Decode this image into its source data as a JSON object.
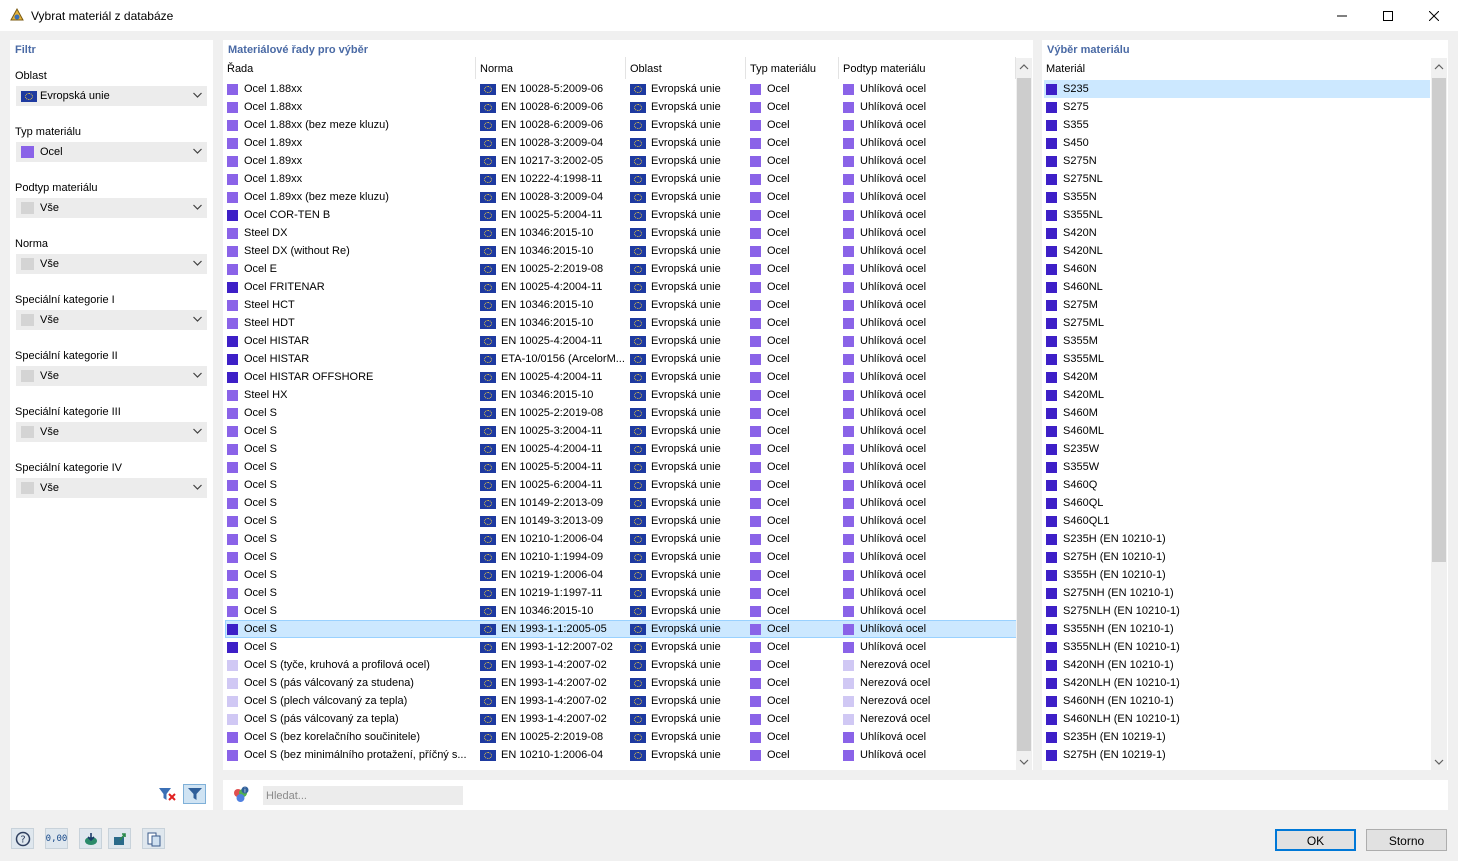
{
  "window": {
    "title": "Vybrat materiál z databáze"
  },
  "filter": {
    "title": "Filtr",
    "fields": [
      {
        "label": "Oblast",
        "value": "Evropská unie",
        "icon": "eu-flag",
        "color": "#1e3aa0"
      },
      {
        "label": "Typ materiálu",
        "value": "Ocel",
        "icon": "material-color",
        "color": "#8a63e8"
      },
      {
        "label": "Podtyp materiálu",
        "value": "Vše",
        "icon": "none",
        "color": "#d4d4d4"
      },
      {
        "label": "Norma",
        "value": "Vše",
        "icon": "none",
        "color": "#d4d4d4"
      },
      {
        "label": "Speciální kategorie I",
        "value": "Vše",
        "icon": "none",
        "color": "#d4d4d4"
      },
      {
        "label": "Speciální kategorie II",
        "value": "Vše",
        "icon": "none",
        "color": "#d4d4d4"
      },
      {
        "label": "Speciální kategorie III",
        "value": "Vše",
        "icon": "none",
        "color": "#d4d4d4"
      },
      {
        "label": "Speciální kategorie IV",
        "value": "Vše",
        "icon": "none",
        "color": "#d4d4d4"
      }
    ],
    "buttons": [
      "clear-filter-icon",
      "filter-icon"
    ]
  },
  "series": {
    "title": "Materiálové řady pro výběr",
    "columns": [
      "Řada",
      "Norma",
      "Oblast",
      "Typ materiálu",
      "Podtyp materiálu"
    ],
    "rows": [
      {
        "name": "Ocel 1.88xx",
        "norm": "EN 10028-5:2009-06",
        "region": "Evropská unie",
        "type": "Ocel",
        "subtype": "Uhlíková ocel",
        "color": "#8a63e8",
        "subcolor": "#8a63e8"
      },
      {
        "name": "Ocel 1.88xx",
        "norm": "EN 10028-6:2009-06",
        "region": "Evropská unie",
        "type": "Ocel",
        "subtype": "Uhlíková ocel",
        "color": "#8a63e8",
        "subcolor": "#8a63e8"
      },
      {
        "name": "Ocel 1.88xx (bez meze kluzu)",
        "norm": "EN 10028-6:2009-06",
        "region": "Evropská unie",
        "type": "Ocel",
        "subtype": "Uhlíková ocel",
        "color": "#8a63e8",
        "subcolor": "#8a63e8"
      },
      {
        "name": "Ocel 1.89xx",
        "norm": "EN 10028-3:2009-04",
        "region": "Evropská unie",
        "type": "Ocel",
        "subtype": "Uhlíková ocel",
        "color": "#8a63e8",
        "subcolor": "#8a63e8"
      },
      {
        "name": "Ocel 1.89xx",
        "norm": "EN 10217-3:2002-05",
        "region": "Evropská unie",
        "type": "Ocel",
        "subtype": "Uhlíková ocel",
        "color": "#8a63e8",
        "subcolor": "#8a63e8"
      },
      {
        "name": "Ocel 1.89xx",
        "norm": "EN 10222-4:1998-11",
        "region": "Evropská unie",
        "type": "Ocel",
        "subtype": "Uhlíková ocel",
        "color": "#8a63e8",
        "subcolor": "#8a63e8"
      },
      {
        "name": "Ocel 1.89xx (bez meze kluzu)",
        "norm": "EN 10028-3:2009-04",
        "region": "Evropská unie",
        "type": "Ocel",
        "subtype": "Uhlíková ocel",
        "color": "#8a63e8",
        "subcolor": "#8a63e8"
      },
      {
        "name": "Ocel COR-TEN B",
        "norm": "EN 10025-5:2004-11",
        "region": "Evropská unie",
        "type": "Ocel",
        "subtype": "Uhlíková ocel",
        "color": "#3d1fc7",
        "subcolor": "#8a63e8"
      },
      {
        "name": "Steel DX",
        "norm": "EN 10346:2015-10",
        "region": "Evropská unie",
        "type": "Ocel",
        "subtype": "Uhlíková ocel",
        "color": "#8a63e8",
        "subcolor": "#8a63e8"
      },
      {
        "name": "Steel DX (without Re)",
        "norm": "EN 10346:2015-10",
        "region": "Evropská unie",
        "type": "Ocel",
        "subtype": "Uhlíková ocel",
        "color": "#8a63e8",
        "subcolor": "#8a63e8"
      },
      {
        "name": "Ocel E",
        "norm": "EN 10025-2:2019-08",
        "region": "Evropská unie",
        "type": "Ocel",
        "subtype": "Uhlíková ocel",
        "color": "#8a63e8",
        "subcolor": "#8a63e8"
      },
      {
        "name": "Ocel FRITENAR",
        "norm": "EN 10025-4:2004-11",
        "region": "Evropská unie",
        "type": "Ocel",
        "subtype": "Uhlíková ocel",
        "color": "#3d1fc7",
        "subcolor": "#8a63e8"
      },
      {
        "name": "Steel HCT",
        "norm": "EN 10346:2015-10",
        "region": "Evropská unie",
        "type": "Ocel",
        "subtype": "Uhlíková ocel",
        "color": "#8a63e8",
        "subcolor": "#8a63e8"
      },
      {
        "name": "Steel HDT",
        "norm": "EN 10346:2015-10",
        "region": "Evropská unie",
        "type": "Ocel",
        "subtype": "Uhlíková ocel",
        "color": "#8a63e8",
        "subcolor": "#8a63e8"
      },
      {
        "name": "Ocel HISTAR",
        "norm": "EN 10025-4:2004-11",
        "region": "Evropská unie",
        "type": "Ocel",
        "subtype": "Uhlíková ocel",
        "color": "#3d1fc7",
        "subcolor": "#8a63e8"
      },
      {
        "name": "Ocel HISTAR",
        "norm": "ETA-10/0156 (ArcelorM...",
        "region": "Evropská unie",
        "type": "Ocel",
        "subtype": "Uhlíková ocel",
        "color": "#3d1fc7",
        "subcolor": "#8a63e8"
      },
      {
        "name": "Ocel HISTAR OFFSHORE",
        "norm": "EN 10025-4:2004-11",
        "region": "Evropská unie",
        "type": "Ocel",
        "subtype": "Uhlíková ocel",
        "color": "#3d1fc7",
        "subcolor": "#8a63e8"
      },
      {
        "name": "Steel HX",
        "norm": "EN 10346:2015-10",
        "region": "Evropská unie",
        "type": "Ocel",
        "subtype": "Uhlíková ocel",
        "color": "#8a63e8",
        "subcolor": "#8a63e8"
      },
      {
        "name": "Ocel S",
        "norm": "EN 10025-2:2019-08",
        "region": "Evropská unie",
        "type": "Ocel",
        "subtype": "Uhlíková ocel",
        "color": "#8a63e8",
        "subcolor": "#8a63e8"
      },
      {
        "name": "Ocel S",
        "norm": "EN 10025-3:2004-11",
        "region": "Evropská unie",
        "type": "Ocel",
        "subtype": "Uhlíková ocel",
        "color": "#8a63e8",
        "subcolor": "#8a63e8"
      },
      {
        "name": "Ocel S",
        "norm": "EN 10025-4:2004-11",
        "region": "Evropská unie",
        "type": "Ocel",
        "subtype": "Uhlíková ocel",
        "color": "#8a63e8",
        "subcolor": "#8a63e8"
      },
      {
        "name": "Ocel S",
        "norm": "EN 10025-5:2004-11",
        "region": "Evropská unie",
        "type": "Ocel",
        "subtype": "Uhlíková ocel",
        "color": "#8a63e8",
        "subcolor": "#8a63e8"
      },
      {
        "name": "Ocel S",
        "norm": "EN 10025-6:2004-11",
        "region": "Evropská unie",
        "type": "Ocel",
        "subtype": "Uhlíková ocel",
        "color": "#8a63e8",
        "subcolor": "#8a63e8"
      },
      {
        "name": "Ocel S",
        "norm": "EN 10149-2:2013-09",
        "region": "Evropská unie",
        "type": "Ocel",
        "subtype": "Uhlíková ocel",
        "color": "#8a63e8",
        "subcolor": "#8a63e8"
      },
      {
        "name": "Ocel S",
        "norm": "EN 10149-3:2013-09",
        "region": "Evropská unie",
        "type": "Ocel",
        "subtype": "Uhlíková ocel",
        "color": "#8a63e8",
        "subcolor": "#8a63e8"
      },
      {
        "name": "Ocel S",
        "norm": "EN 10210-1:2006-04",
        "region": "Evropská unie",
        "type": "Ocel",
        "subtype": "Uhlíková ocel",
        "color": "#8a63e8",
        "subcolor": "#8a63e8"
      },
      {
        "name": "Ocel S",
        "norm": "EN 10210-1:1994-09",
        "region": "Evropská unie",
        "type": "Ocel",
        "subtype": "Uhlíková ocel",
        "color": "#8a63e8",
        "subcolor": "#8a63e8"
      },
      {
        "name": "Ocel S",
        "norm": "EN 10219-1:2006-04",
        "region": "Evropská unie",
        "type": "Ocel",
        "subtype": "Uhlíková ocel",
        "color": "#8a63e8",
        "subcolor": "#8a63e8"
      },
      {
        "name": "Ocel S",
        "norm": "EN 10219-1:1997-11",
        "region": "Evropská unie",
        "type": "Ocel",
        "subtype": "Uhlíková ocel",
        "color": "#8a63e8",
        "subcolor": "#8a63e8"
      },
      {
        "name": "Ocel S",
        "norm": "EN 10346:2015-10",
        "region": "Evropská unie",
        "type": "Ocel",
        "subtype": "Uhlíková ocel",
        "color": "#8a63e8",
        "subcolor": "#8a63e8"
      },
      {
        "name": "Ocel S",
        "norm": "EN 1993-1-1:2005-05",
        "region": "Evropská unie",
        "type": "Ocel",
        "subtype": "Uhlíková ocel",
        "color": "#3d1fc7",
        "subcolor": "#8a63e8",
        "selected": true
      },
      {
        "name": "Ocel S",
        "norm": "EN 1993-1-12:2007-02",
        "region": "Evropská unie",
        "type": "Ocel",
        "subtype": "Uhlíková ocel",
        "color": "#3d1fc7",
        "subcolor": "#8a63e8"
      },
      {
        "name": "Ocel S (tyče, kruhová a profilová ocel)",
        "norm": "EN 1993-1-4:2007-02",
        "region": "Evropská unie",
        "type": "Ocel",
        "subtype": "Nerezová ocel",
        "color": "#d0c8f4",
        "subcolor": "#d0c8f4"
      },
      {
        "name": "Ocel S (pás válcovaný za studena)",
        "norm": "EN 1993-1-4:2007-02",
        "region": "Evropská unie",
        "type": "Ocel",
        "subtype": "Nerezová ocel",
        "color": "#d0c8f4",
        "subcolor": "#d0c8f4"
      },
      {
        "name": "Ocel S (plech válcovaný za tepla)",
        "norm": "EN 1993-1-4:2007-02",
        "region": "Evropská unie",
        "type": "Ocel",
        "subtype": "Nerezová ocel",
        "color": "#d0c8f4",
        "subcolor": "#d0c8f4"
      },
      {
        "name": "Ocel S (pás válcovaný za tepla)",
        "norm": "EN 1993-1-4:2007-02",
        "region": "Evropská unie",
        "type": "Ocel",
        "subtype": "Nerezová ocel",
        "color": "#d0c8f4",
        "subcolor": "#d0c8f4"
      },
      {
        "name": "Ocel S (bez korelačního součinitele)",
        "norm": "EN 10025-2:2019-08",
        "region": "Evropská unie",
        "type": "Ocel",
        "subtype": "Uhlíková ocel",
        "color": "#8a63e8",
        "subcolor": "#8a63e8"
      },
      {
        "name": "Ocel S (bez minimálního protažení, příčný s...",
        "norm": "EN 10210-1:2006-04",
        "region": "Evropská unie",
        "type": "Ocel",
        "subtype": "Uhlíková ocel",
        "color": "#8a63e8",
        "subcolor": "#8a63e8"
      }
    ]
  },
  "materials": {
    "title": "Výběr materiálu",
    "column": "Materiál",
    "items": [
      "S235",
      "S275",
      "S355",
      "S450",
      "S275N",
      "S275NL",
      "S355N",
      "S355NL",
      "S420N",
      "S420NL",
      "S460N",
      "S460NL",
      "S275M",
      "S275ML",
      "S355M",
      "S355ML",
      "S420M",
      "S420ML",
      "S460M",
      "S460ML",
      "S235W",
      "S355W",
      "S460Q",
      "S460QL",
      "S460QL1",
      "S235H (EN 10210-1)",
      "S275H (EN 10210-1)",
      "S355H (EN 10210-1)",
      "S275NH (EN 10210-1)",
      "S275NLH (EN 10210-1)",
      "S355NH (EN 10210-1)",
      "S355NLH (EN 10210-1)",
      "S420NH (EN 10210-1)",
      "S420NLH (EN 10210-1)",
      "S460NH (EN 10210-1)",
      "S460NLH (EN 10210-1)",
      "S235H (EN 10219-1)",
      "S275H (EN 10219-1)"
    ],
    "selected_index": 0,
    "color": "#3d1fc7"
  },
  "search": {
    "placeholder": "Hledat..."
  },
  "footer": {
    "ok_label": "OK",
    "cancel_label": "Storno",
    "zero_label": "0,00"
  }
}
